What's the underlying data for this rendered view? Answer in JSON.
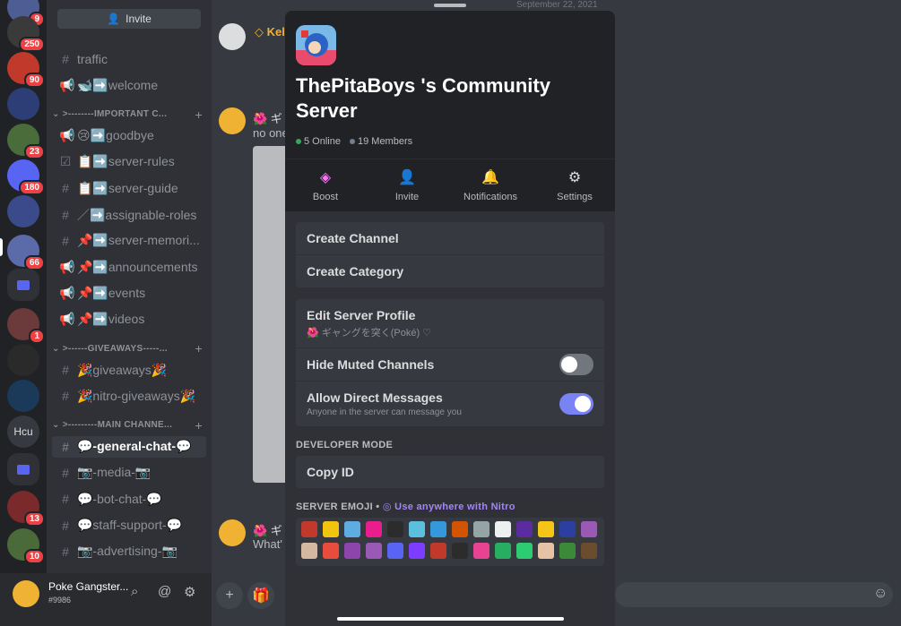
{
  "rail": {
    "servers": [
      {
        "label": "",
        "badge": "9",
        "color": "#4e5d94"
      },
      {
        "label": "",
        "badge": "250",
        "color": "#3a3a3a"
      },
      {
        "label": "",
        "badge": "90",
        "color": "#c0392b"
      },
      {
        "label": "",
        "badge": "",
        "color": "#2c3e75"
      },
      {
        "label": "",
        "badge": "23",
        "color": "#4a6b3a"
      },
      {
        "label": "",
        "badge": "180",
        "color": "#5865f2"
      },
      {
        "label": "",
        "badge": "",
        "color": "#3b4a8a"
      },
      {
        "label": "",
        "badge": "66",
        "color": "#5b6aa8"
      },
      {
        "label": "",
        "badge": "",
        "color": "folder"
      },
      {
        "label": "",
        "badge": "1",
        "color": "#6b3b3b"
      },
      {
        "label": "",
        "badge": "",
        "color": "#2a2a2a"
      },
      {
        "label": "",
        "badge": "",
        "color": "#1b3a5a"
      },
      {
        "label": "Hcu",
        "badge": "",
        "color": "#36393f"
      },
      {
        "label": "",
        "badge": "",
        "color": "folder"
      },
      {
        "label": "",
        "badge": "13",
        "color": "#7a2a2a"
      },
      {
        "label": "",
        "badge": "10",
        "color": "#4a6a3a"
      }
    ]
  },
  "channels": {
    "invite_label": "Invite",
    "items": [
      {
        "type": "channel",
        "icon": "#",
        "name": "traffic"
      },
      {
        "type": "channel",
        "icon": "📢",
        "name": "🐋➡️welcome"
      },
      {
        "type": "category",
        "name": ">--------IMPORTANT C..."
      },
      {
        "type": "channel",
        "icon": "📢",
        "name": "😢➡️goodbye"
      },
      {
        "type": "channel",
        "icon": "☑",
        "name": "📋➡️server-rules"
      },
      {
        "type": "channel",
        "icon": "#",
        "name": "📋➡️server-guide"
      },
      {
        "type": "channel",
        "icon": "#",
        "name": "／➡️assignable-roles"
      },
      {
        "type": "channel",
        "icon": "#",
        "name": "📌➡️server-memori..."
      },
      {
        "type": "channel",
        "icon": "📢",
        "name": "📌➡️announcements"
      },
      {
        "type": "channel",
        "icon": "📢",
        "name": "📌➡️events"
      },
      {
        "type": "channel",
        "icon": "📢",
        "name": "📌➡️videos"
      },
      {
        "type": "category",
        "name": ">------GIVEAWAYS-----..."
      },
      {
        "type": "channel",
        "icon": "#",
        "name": "🎉giveaways🎉"
      },
      {
        "type": "channel",
        "icon": "#",
        "name": "🎉nitro-giveaways🎉"
      },
      {
        "type": "category",
        "name": ">---------MAIN CHANNE..."
      },
      {
        "type": "channel",
        "icon": "#",
        "name": "💬-general-chat-💬",
        "active": true
      },
      {
        "type": "channel",
        "icon": "#",
        "name": "📷-media-📷"
      },
      {
        "type": "channel",
        "icon": "#",
        "name": "💬-bot-chat-💬"
      },
      {
        "type": "channel",
        "icon": "#",
        "name": "💬staff-support-💬"
      },
      {
        "type": "channel",
        "icon": "#",
        "name": "📷-advertising-📷"
      }
    ]
  },
  "user": {
    "name": "Poke Gangster...",
    "tag": "#9986"
  },
  "chat": {
    "date": "September 22, 2021",
    "msg1_name": "◇ Kel",
    "msg2_prefix": "🌺 ギ",
    "msg2_text": "no one",
    "msg3_prefix": "🌺 ギ",
    "msg3_text": "What'"
  },
  "sheet": {
    "server_name": "ThePitaBoys 's Community Server",
    "online": "5 Online",
    "members": "19 Members",
    "online_color": "#3ba55d",
    "members_color": "#747f8d",
    "actions": [
      {
        "label": "Boost",
        "icon": "boost-icon"
      },
      {
        "label": "Invite",
        "icon": "add-user-icon"
      },
      {
        "label": "Notifications",
        "icon": "bell-icon"
      },
      {
        "label": "Settings",
        "icon": "gear-icon"
      }
    ],
    "create_channel": "Create Channel",
    "create_category": "Create Category",
    "edit_profile": "Edit Server Profile",
    "edit_profile_sub": "🌺 ギャングを突く(Poké) ♡",
    "hide_muted": "Hide Muted Channels",
    "hide_muted_on": false,
    "allow_dms": "Allow Direct Messages",
    "allow_dms_sub": "Anyone in the server can message you",
    "allow_dms_on": true,
    "dev_mode_title": "DEVELOPER MODE",
    "copy_id": "Copy ID",
    "emoji_title": "SERVER EMOJI",
    "emoji_nitro": "Use anywhere with Nitro",
    "emoji_colors": [
      "#c0392b",
      "#f1c40f",
      "#5dade2",
      "#e91e8c",
      "#2c2c2c",
      "#5bc0de",
      "#3498db",
      "#d35400",
      "#95a5a6",
      "#ecf0f1",
      "#5b2c9f",
      "#f5c518",
      "#2c3e9f",
      "#9b59b6",
      "#d5b8a0",
      "#e74c3c",
      "#8e44ad",
      "#9b59b6",
      "#5865f2",
      "#7d3cff",
      "#c0392b",
      "#2c2c2c",
      "#e84393",
      "#27ae60",
      "#2ecc71",
      "#e6c3a5",
      "#3a8a3a",
      "#6b4c2c"
    ]
  }
}
